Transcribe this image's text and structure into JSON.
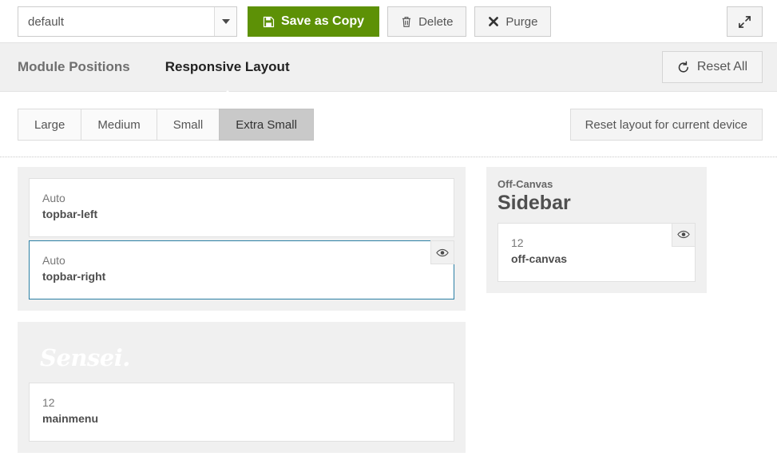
{
  "toolbar": {
    "style_select": {
      "value": "default",
      "placeholder": "default",
      "arrow_icon": "chevron-down-icon"
    },
    "save_label": "Save as Copy",
    "save_icon": "floppy-disk-icon",
    "delete_label": "Delete",
    "delete_icon": "trash-icon",
    "purge_label": "Purge",
    "purge_icon": "cross-icon",
    "expand_icon": "expand-diagonal-icon",
    "accent_green": "#5d9106"
  },
  "tabs": {
    "items": [
      {
        "label": "Module Positions",
        "active": false
      },
      {
        "label": "Responsive Layout",
        "active": true
      }
    ],
    "reset_all_label": "Reset All",
    "reset_all_icon": "undo-arrow-icon"
  },
  "devicebar": {
    "segments": [
      {
        "label": "Large",
        "active": false
      },
      {
        "label": "Medium",
        "active": false
      },
      {
        "label": "Small",
        "active": false
      },
      {
        "label": "Extra Small",
        "active": true
      }
    ],
    "reset_device_label": "Reset layout for current device"
  },
  "layout": {
    "left": {
      "topbar_section": {
        "modules": [
          {
            "span": "Auto",
            "name": "topbar-left",
            "selected": false,
            "has_eye": false,
            "eye_icon": "eye-icon"
          },
          {
            "span": "Auto",
            "name": "topbar-right",
            "selected": true,
            "has_eye": true,
            "eye_icon": "eye-icon"
          }
        ]
      },
      "menu_section": {
        "logo_text": "Sensei.",
        "modules": [
          {
            "span": "12",
            "name": "mainmenu",
            "selected": false,
            "has_eye": false,
            "eye_icon": "eye-icon"
          }
        ]
      }
    },
    "right": {
      "sidebar_section": {
        "kicker": "Off-Canvas",
        "title": "Sidebar",
        "modules": [
          {
            "span": "12",
            "name": "off-canvas",
            "selected": false,
            "has_eye": true,
            "eye_icon": "eye-icon"
          }
        ]
      }
    }
  }
}
